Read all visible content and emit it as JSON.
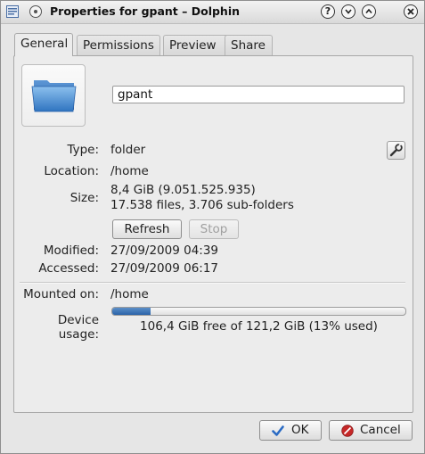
{
  "window": {
    "title": "Properties for gpant – Dolphin",
    "controls": [
      "?",
      "⌄",
      "⌃",
      "✕"
    ]
  },
  "tabs": [
    {
      "label": "General",
      "active": true
    },
    {
      "label": "Permissions",
      "active": false
    },
    {
      "label": "Preview",
      "active": false
    },
    {
      "label": "Share",
      "active": false
    }
  ],
  "general": {
    "name_value": "gpant",
    "type_label": "Type:",
    "type_value": "folder",
    "location_label": "Location:",
    "location_value": "/home",
    "size_label": "Size:",
    "size_value_line1": "8,4 GiB (9.051.525.935)",
    "size_value_line2": "17.538 files, 3.706 sub-folders",
    "refresh_label": "Refresh",
    "stop_label": "Stop",
    "modified_label": "Modified:",
    "modified_value": "27/09/2009 04:39",
    "accessed_label": "Accessed:",
    "accessed_value": "27/09/2009 06:17",
    "mounted_label": "Mounted on:",
    "mounted_value": "/home",
    "usage_label": "Device usage:",
    "usage_text": "106,4 GiB free of 121,2 GiB (13% used)",
    "usage_fraction": 0.13
  },
  "footer": {
    "ok_label": "OK",
    "cancel_label": "Cancel"
  },
  "colors": {
    "progress_fill": "#2a63a8",
    "folder_blue": "#3f88d0",
    "cancel_red": "#c62828",
    "ok_blue": "#2a6bc4"
  }
}
